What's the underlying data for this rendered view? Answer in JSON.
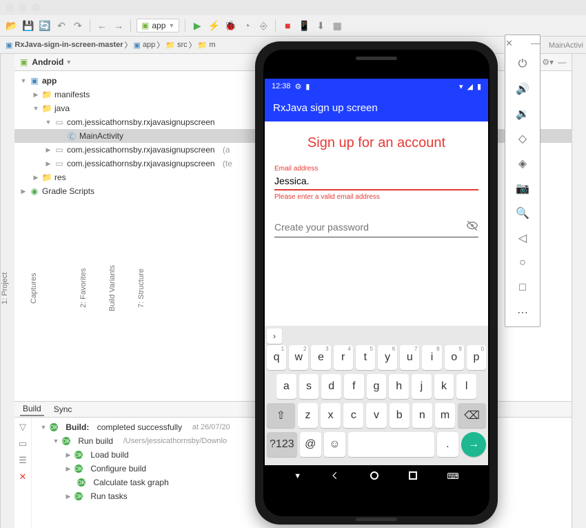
{
  "breadcrumb": {
    "items": [
      "RxJava-sign-in-screen-master",
      "app",
      "src",
      "m"
    ]
  },
  "runconfig": {
    "label": "app"
  },
  "project_selector": "Android",
  "right_file_tab": "MainActivi",
  "tree": {
    "app": "app",
    "manifests": "manifests",
    "java": "java",
    "pkg1": "com.jessicathornsby.rxjavasignupscreen",
    "mainactivity": "MainActivity",
    "pkg2": "com.jessicathornsby.rxjavasignupscreen",
    "pkg2suffix": "(a",
    "pkg3": "com.jessicathornsby.rxjavasignupscreen",
    "pkg3suffix": "(te",
    "res": "res",
    "gradle": "Gradle Scripts"
  },
  "left_tabs": {
    "project": "1: Project",
    "captures": "Captures",
    "favorites": "2: Favorites",
    "buildvariants": "Build Variants",
    "structure": "7: Structure"
  },
  "build": {
    "tab_build": "Build",
    "tab_sync": "Sync",
    "root": "Build:",
    "root_status": "completed successfully",
    "root_ts": "at 26/07/20",
    "run": "Run build",
    "run_path": "/Users/jessicathornsby/Downlo",
    "load": "Load build",
    "configure": "Configure build",
    "calc": "Calculate task graph",
    "runtasks": "Run tasks"
  },
  "phone": {
    "time": "12:38",
    "app_title": "RxJava sign up screen",
    "heading": "Sign up for an account",
    "email_label": "Email address",
    "email_value": "Jessica.",
    "email_error": "Please enter a valid email address",
    "password_placeholder": "Create your password"
  },
  "keyboard": {
    "row1": [
      "q",
      "w",
      "e",
      "r",
      "t",
      "y",
      "u",
      "i",
      "o",
      "p"
    ],
    "row1sup": [
      "1",
      "2",
      "3",
      "4",
      "5",
      "6",
      "7",
      "8",
      "9",
      "0"
    ],
    "row2": [
      "a",
      "s",
      "d",
      "f",
      "g",
      "h",
      "j",
      "k",
      "l"
    ],
    "row3": [
      "z",
      "x",
      "c",
      "v",
      "b",
      "n",
      "m"
    ],
    "sym": "?123",
    "at": "@",
    "period": "."
  }
}
